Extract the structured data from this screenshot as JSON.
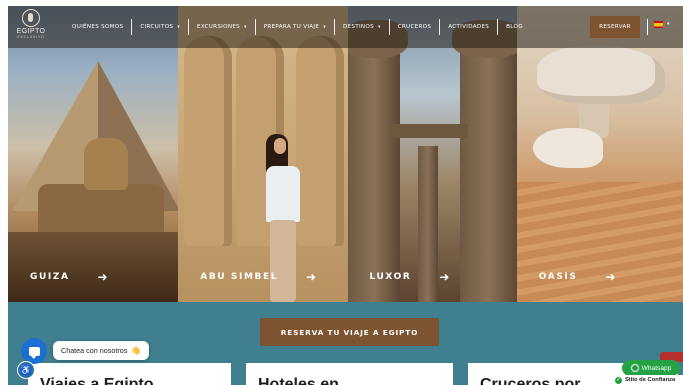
{
  "header": {
    "logo": {
      "name": "EGIPTO",
      "sub": "EXCLUSIVO"
    },
    "nav": [
      {
        "label": "QUIÉNES SOMOS",
        "dropdown": false
      },
      {
        "label": "CIRCUITOS",
        "dropdown": true
      },
      {
        "label": "EXCURSIONES",
        "dropdown": true
      },
      {
        "label": "PREPARA TU VIAJE",
        "dropdown": true
      },
      {
        "label": "DESTINOS",
        "dropdown": true
      },
      {
        "label": "CRUCEROS",
        "dropdown": false
      },
      {
        "label": "ACTIVIDADES",
        "dropdown": false
      },
      {
        "label": "BLOG",
        "dropdown": false
      }
    ],
    "reservar_label": "RESERVAR",
    "language": {
      "flag": "spain-flag",
      "chevron": "▾"
    },
    "chevron": "▾"
  },
  "hero": {
    "panels": [
      {
        "label": "GUIZA",
        "arrow": "➜"
      },
      {
        "label": "ABU SIMBEL",
        "arrow": "➜"
      },
      {
        "label": "LUXOR",
        "arrow": "➜"
      },
      {
        "label": "OASIS",
        "arrow": "➜"
      }
    ]
  },
  "booking": {
    "cta_label": "RESERVA TU VIAJE A EGIPTO"
  },
  "cards": [
    {
      "title": "Viajes a Egipto"
    },
    {
      "title": "Hoteles en..."
    },
    {
      "title": "Cruceros por..."
    }
  ],
  "chat": {
    "label": "Chatea con nosotros",
    "emoji": "👋"
  },
  "whatsapp": {
    "label": "Whatsapp"
  },
  "trust": {
    "label": "Sitio de Confianza",
    "check": "✓"
  },
  "accessibility": {
    "icon": "♿"
  },
  "colors": {
    "accent_brown": "#7d5330",
    "band_teal": "#3f7f90",
    "chat_blue": "#1b6fd1",
    "whatsapp_green": "#25a244"
  }
}
